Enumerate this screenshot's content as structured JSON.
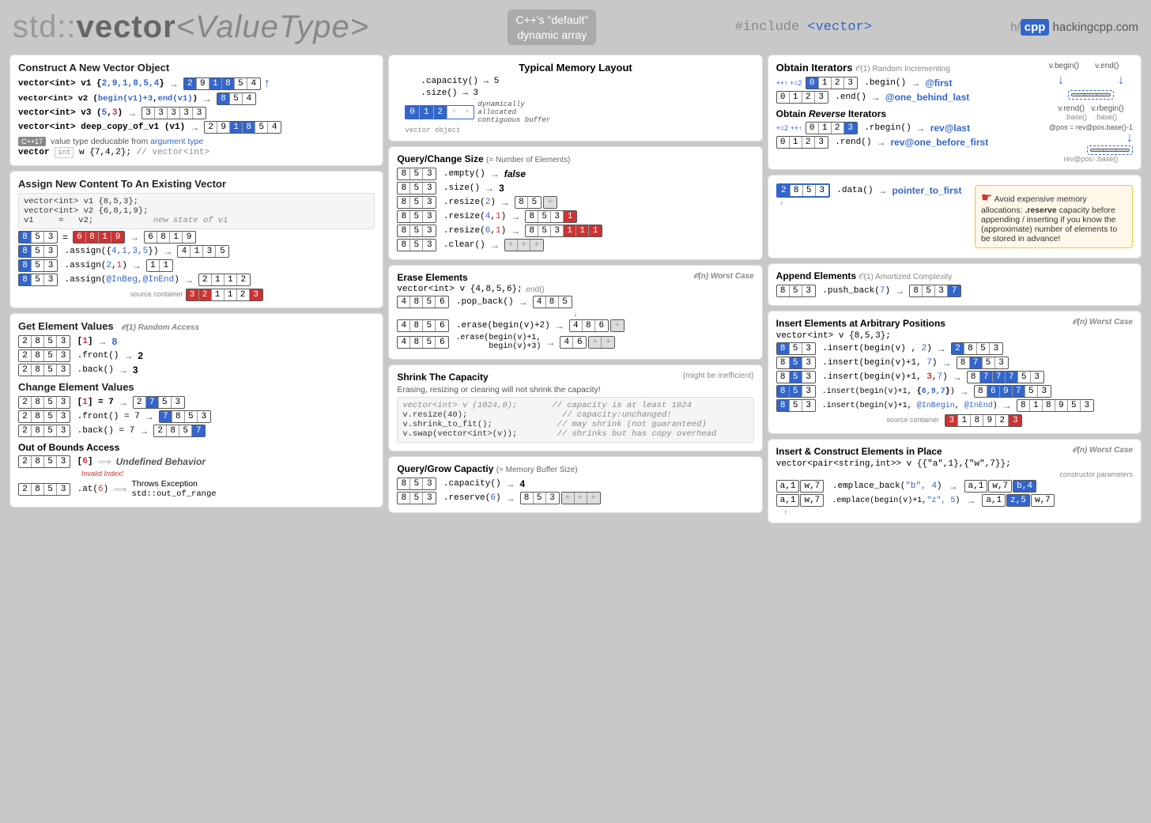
{
  "header": {
    "title_prefix": "std::vector",
    "title_type": "<ValueType>",
    "badge_line1": "C++'s \"default\"",
    "badge_line2": "dynamic array",
    "include_text": "#include <vector>",
    "site_h": "h/",
    "site_cpp": "cpp",
    "site_domain": "hackingcpp.com"
  },
  "sections": {
    "construct": {
      "title_bold": "Construct",
      "title_normal": " A New Vector Object",
      "items": [
        "vector<int> v1 {2,9,1,8,5,4}",
        "vector<int> v2 (begin(v1)+3,end(v1))",
        "vector<int> v3 (5,3)",
        "vector<int> deep_copy_of_v1 (v1)"
      ]
    },
    "assign": {
      "title_bold": "Assign",
      "title_normal": " New Content To An Existing Vector"
    },
    "get": {
      "title_bold": "Get",
      "title_normal": " Element Values"
    },
    "change": {
      "title_bold": "Change",
      "title_normal": " Element Values"
    },
    "query_size": {
      "title": "Query/Change Size",
      "eq_note": "(= Number of Elements)"
    },
    "erase": {
      "title_bold": "Erase",
      "title_normal": " Elements"
    },
    "shrink": {
      "title_bold": "Shrink",
      "title_normal": " The Capacity"
    },
    "query_capacity": {
      "title": "Query/Grow Capactiy",
      "eq_note": "(= Memory Buffer Size)"
    },
    "iterators": {
      "title_bold": "Obtain Iterators"
    },
    "reverse_iterators": {
      "title": "Obtain Reverse Iterators"
    },
    "data": {
      "label": ".data()"
    },
    "append": {
      "title_bold": "Append",
      "title_normal": " Elements"
    },
    "insert": {
      "title_bold": "Insert",
      "title_normal": " Elements at Arbitrary Positions"
    },
    "emplace": {
      "title_bold": "Insert & Construct",
      "title_normal": " Elements in Place"
    }
  }
}
